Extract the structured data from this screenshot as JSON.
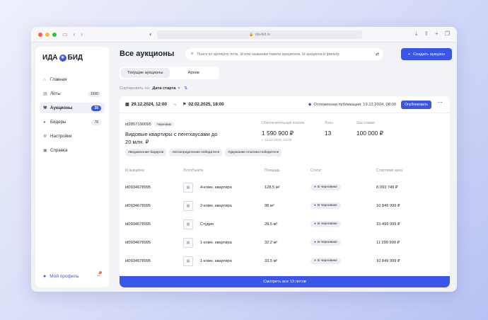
{
  "browser": {
    "url": "ida-bid.ru",
    "colors": {
      "close": "#ff5f57",
      "minimize": "#febc2e",
      "zoom": "#28c840"
    }
  },
  "app": {
    "logo_text_left": "ИДА",
    "logo_text_right": "БИД",
    "accent": "#3a56e8"
  },
  "sidebar": {
    "items": [
      {
        "label": "Главная",
        "icon": "home-icon",
        "count": ""
      },
      {
        "label": "Лоты",
        "icon": "lots-icon",
        "count": "1690"
      },
      {
        "label": "Аукционы",
        "icon": "auction-icon",
        "count": "30"
      },
      {
        "label": "Бидеры",
        "icon": "bidders-icon",
        "count": "78"
      },
      {
        "label": "Настройки",
        "icon": "gear-icon",
        "count": ""
      },
      {
        "label": "Справка",
        "icon": "help-icon",
        "count": ""
      }
    ],
    "profile_label": "Мой профиль"
  },
  "header": {
    "title": "Все аукционы",
    "search_placeholder": "Поиск по артикулу лота, Id или названию пакета аукционов, Id аукциона и фильтр",
    "create_label": "Создать аукцион"
  },
  "tabs": [
    "Текущие аукционы",
    "Архив"
  ],
  "sort": {
    "label": "Сортировать по:",
    "value": "Дата старта"
  },
  "card": {
    "start": "29.12.2024, 12:00",
    "end": "02.02.2025, 18:00",
    "deferred": "Отложенная публикация: 19.12.2024, 08:00",
    "publish_label": "Опубликовать",
    "lot_id": "id2857190095",
    "badge": "Черновик",
    "title": "Видовые квартиры с пентхаусами до 20 млн. ₽",
    "deposit_label": "Обеспечительный платеж",
    "deposit_value": "1 590 900 ₽",
    "deposit_sub": "с 13.12.2024, 18:00",
    "lots_label": "Лоты",
    "lots_value": "13",
    "step_label": "Шаг ставки",
    "step_value": "100 000 ₽",
    "chips": [
      "Уведомление бидеров",
      "Автоопределение победителя",
      "Удержание платежа победителя"
    ],
    "columns": [
      "Id аукциона",
      "Лот/объекта",
      "Площадь",
      "Статус",
      "Стартовая цена"
    ],
    "rows": [
      {
        "id": "id0934678995",
        "name": "4-комн. квартира",
        "area": "128.5 м²",
        "status": "В черновике",
        "price": "8 093 749 ₽"
      },
      {
        "id": "id0934678995",
        "name": "2-комн. квартира",
        "area": "98 м²",
        "status": "В черновике",
        "price": "10 849 999 ₽"
      },
      {
        "id": "id0934678995",
        "name": "Студия",
        "area": "28.5 м²",
        "status": "В черновике",
        "price": "15 499 999 ₽"
      },
      {
        "id": "id0934678995",
        "name": "1-комн. квартира",
        "area": "32.2 м²",
        "status": "В черновике",
        "price": "11 299 999 ₽"
      },
      {
        "id": "id0934678995",
        "name": "1-комн. квартира",
        "area": "33.5 м²",
        "status": "В черновике",
        "price": "10 849 999 ₽"
      }
    ],
    "view_all_label": "Смотреть все 13 лотов"
  }
}
